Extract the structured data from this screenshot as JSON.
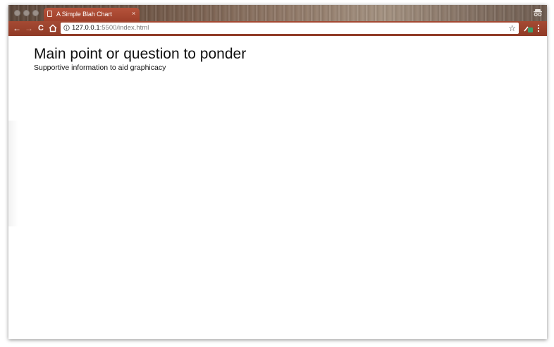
{
  "browser": {
    "tab": {
      "title": "A Simple Blah Chart",
      "close_glyph": "×",
      "icon": "document-icon"
    },
    "address_bar": {
      "url_host": "127.0.0.1",
      "url_rest": ":5500/index.html",
      "icon": "info-icon",
      "bookmark_glyph": "☆"
    },
    "nav": {
      "back_glyph": "←",
      "forward_glyph": "→",
      "reload_glyph": "C",
      "home_icon": "home-icon"
    },
    "colors": {
      "titlebar": "#7a6253",
      "tab": "#a84a33",
      "toolbar": "#9b4430",
      "ext_accent": "#3aa06a"
    }
  },
  "page": {
    "title": "Main point or question to ponder",
    "subtitle": "Supportive information to aid graphicacy"
  }
}
